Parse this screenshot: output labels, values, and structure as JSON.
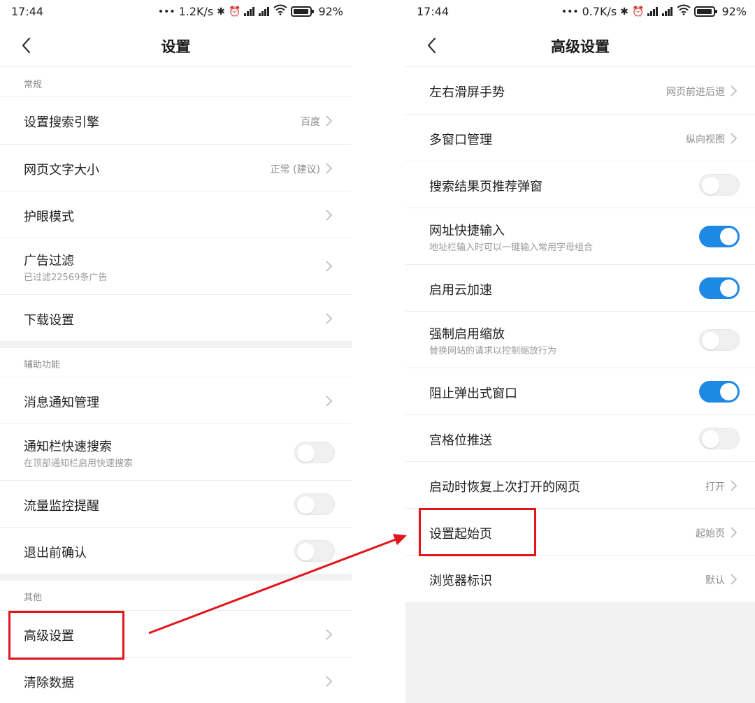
{
  "left_screen": {
    "status": {
      "time": "17:44",
      "net_speed": "1.2K/s",
      "battery": "92%"
    },
    "title": "设置",
    "sections": [
      {
        "header": "常规",
        "rows": [
          {
            "label": "设置搜索引擎",
            "value": "百度"
          },
          {
            "label": "网页文字大小",
            "value": "正常 (建议)"
          },
          {
            "label": "护眼模式"
          },
          {
            "label": "广告过滤",
            "subtitle": "已过滤22569条广告"
          },
          {
            "label": "下载设置"
          }
        ]
      },
      {
        "header": "辅助功能",
        "rows": [
          {
            "label": "消息通知管理"
          },
          {
            "label": "通知栏快速搜索",
            "subtitle": "在顶部通知栏启用快速搜索",
            "toggle": "off"
          },
          {
            "label": "流量监控提醒",
            "toggle": "off"
          },
          {
            "label": "退出前确认",
            "toggle": "off"
          }
        ]
      },
      {
        "header": "其他",
        "rows": [
          {
            "label": "高级设置"
          },
          {
            "label": "清除数据"
          }
        ]
      }
    ]
  },
  "right_screen": {
    "status": {
      "time": "17:44",
      "net_speed": "0.7K/s",
      "battery": "92%"
    },
    "title": "高级设置",
    "rows": [
      {
        "label": "左右滑屏手势",
        "value": "网页前进后退"
      },
      {
        "label": "多窗口管理",
        "value": "纵向视图"
      },
      {
        "label": "搜索结果页推荐弹窗",
        "toggle": "off"
      },
      {
        "label": "网址快捷输入",
        "subtitle": "地址栏输入时可以一键输入常用字母组合",
        "toggle": "on"
      },
      {
        "label": "启用云加速",
        "toggle": "on"
      },
      {
        "label": "强制启用缩放",
        "subtitle": "替换网站的请求以控制缩放行为",
        "toggle": "off"
      },
      {
        "label": "阻止弹出式窗口",
        "toggle": "on"
      },
      {
        "label": "宫格位推送",
        "toggle": "off"
      },
      {
        "label": "启动时恢复上次打开的网页",
        "value": "打开"
      },
      {
        "label": "设置起始页",
        "value": "起始页"
      },
      {
        "label": "浏览器标识",
        "value": "默认"
      }
    ]
  },
  "colors": {
    "toggle_on": "#1e88e5",
    "annotation_red": "#e0161c",
    "section_gap": "#f2f2f2"
  },
  "annotations": [
    {
      "type": "highlight-box",
      "target": "left_screen.高级设置"
    },
    {
      "type": "highlight-box",
      "target": "right_screen.设置起始页"
    },
    {
      "type": "arrow",
      "from": "left_screen.高级设置",
      "to": "right_screen.设置起始页"
    }
  ]
}
